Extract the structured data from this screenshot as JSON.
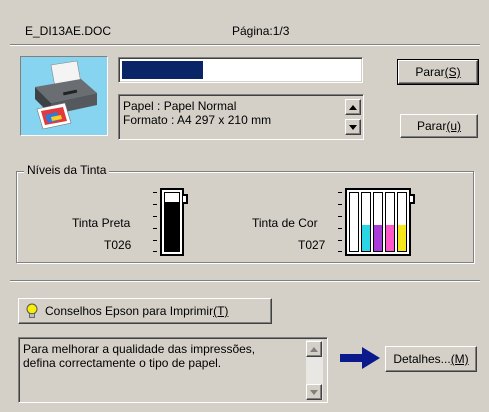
{
  "header": {
    "filename": "E_DI13AE.DOC",
    "page_label": "Página:1/3"
  },
  "progress": {
    "fraction": 0.34,
    "color": "#0a2468"
  },
  "info_box": {
    "line1": "Papel : Papel Normal",
    "line2": "Formato : A4 297 x 210 mm"
  },
  "buttons": {
    "stop_label": "Parar",
    "stop_shortcut": "(S)",
    "pause_label": "Parar",
    "pause_shortcut": "(u)",
    "tips_label": "Conselhos Epson para Imprimir",
    "tips_shortcut": "(T)",
    "details_label": "Detalhes...",
    "details_shortcut": "(M)"
  },
  "ink_levels": {
    "title": "Níveis da Tinta",
    "black": {
      "name": "Tinta Preta",
      "code": "T026",
      "level": 0.85
    },
    "color": {
      "name": "Tinta de Cor",
      "code": "T027",
      "cells": [
        {
          "color": "#ffffff",
          "level": 0
        },
        {
          "color": "#2ad6e6",
          "level": 0.45
        },
        {
          "color": "#a93bd9",
          "level": 0.45
        },
        {
          "color": "#ff58c8",
          "level": 0.45
        },
        {
          "color": "#f5e81a",
          "level": 0.45
        }
      ]
    }
  },
  "tips_text": {
    "line1": "Para melhorar a qualidade das impressões,",
    "line2": "defina correctamente o tipo de papel."
  },
  "icons": {
    "printer": "printer-icon",
    "bulb": "light-bulb-icon",
    "arrow": "right-arrow-icon"
  }
}
